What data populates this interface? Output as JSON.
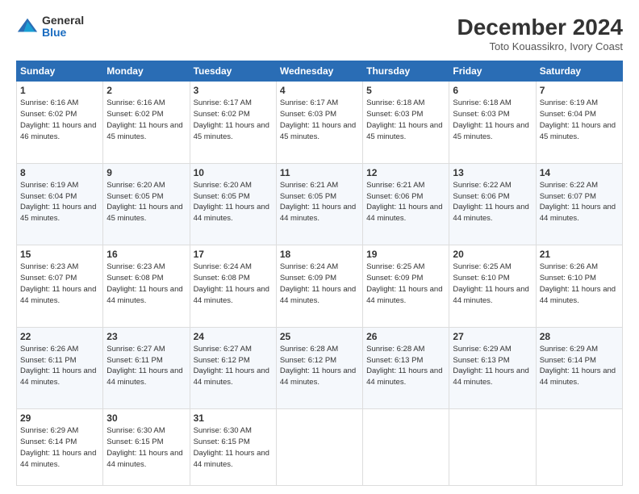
{
  "logo": {
    "general": "General",
    "blue": "Blue"
  },
  "header": {
    "month": "December 2024",
    "location": "Toto Kouassikro, Ivory Coast"
  },
  "days_of_week": [
    "Sunday",
    "Monday",
    "Tuesday",
    "Wednesday",
    "Thursday",
    "Friday",
    "Saturday"
  ],
  "weeks": [
    [
      {
        "day": 1,
        "rise": "6:16 AM",
        "set": "6:02 PM",
        "daylight": "11 hours and 46 minutes."
      },
      {
        "day": 2,
        "rise": "6:16 AM",
        "set": "6:02 PM",
        "daylight": "11 hours and 45 minutes."
      },
      {
        "day": 3,
        "rise": "6:17 AM",
        "set": "6:02 PM",
        "daylight": "11 hours and 45 minutes."
      },
      {
        "day": 4,
        "rise": "6:17 AM",
        "set": "6:03 PM",
        "daylight": "11 hours and 45 minutes."
      },
      {
        "day": 5,
        "rise": "6:18 AM",
        "set": "6:03 PM",
        "daylight": "11 hours and 45 minutes."
      },
      {
        "day": 6,
        "rise": "6:18 AM",
        "set": "6:03 PM",
        "daylight": "11 hours and 45 minutes."
      },
      {
        "day": 7,
        "rise": "6:19 AM",
        "set": "6:04 PM",
        "daylight": "11 hours and 45 minutes."
      }
    ],
    [
      {
        "day": 8,
        "rise": "6:19 AM",
        "set": "6:04 PM",
        "daylight": "11 hours and 45 minutes."
      },
      {
        "day": 9,
        "rise": "6:20 AM",
        "set": "6:05 PM",
        "daylight": "11 hours and 45 minutes."
      },
      {
        "day": 10,
        "rise": "6:20 AM",
        "set": "6:05 PM",
        "daylight": "11 hours and 44 minutes."
      },
      {
        "day": 11,
        "rise": "6:21 AM",
        "set": "6:05 PM",
        "daylight": "11 hours and 44 minutes."
      },
      {
        "day": 12,
        "rise": "6:21 AM",
        "set": "6:06 PM",
        "daylight": "11 hours and 44 minutes."
      },
      {
        "day": 13,
        "rise": "6:22 AM",
        "set": "6:06 PM",
        "daylight": "11 hours and 44 minutes."
      },
      {
        "day": 14,
        "rise": "6:22 AM",
        "set": "6:07 PM",
        "daylight": "11 hours and 44 minutes."
      }
    ],
    [
      {
        "day": 15,
        "rise": "6:23 AM",
        "set": "6:07 PM",
        "daylight": "11 hours and 44 minutes."
      },
      {
        "day": 16,
        "rise": "6:23 AM",
        "set": "6:08 PM",
        "daylight": "11 hours and 44 minutes."
      },
      {
        "day": 17,
        "rise": "6:24 AM",
        "set": "6:08 PM",
        "daylight": "11 hours and 44 minutes."
      },
      {
        "day": 18,
        "rise": "6:24 AM",
        "set": "6:09 PM",
        "daylight": "11 hours and 44 minutes."
      },
      {
        "day": 19,
        "rise": "6:25 AM",
        "set": "6:09 PM",
        "daylight": "11 hours and 44 minutes."
      },
      {
        "day": 20,
        "rise": "6:25 AM",
        "set": "6:10 PM",
        "daylight": "11 hours and 44 minutes."
      },
      {
        "day": 21,
        "rise": "6:26 AM",
        "set": "6:10 PM",
        "daylight": "11 hours and 44 minutes."
      }
    ],
    [
      {
        "day": 22,
        "rise": "6:26 AM",
        "set": "6:11 PM",
        "daylight": "11 hours and 44 minutes."
      },
      {
        "day": 23,
        "rise": "6:27 AM",
        "set": "6:11 PM",
        "daylight": "11 hours and 44 minutes."
      },
      {
        "day": 24,
        "rise": "6:27 AM",
        "set": "6:12 PM",
        "daylight": "11 hours and 44 minutes."
      },
      {
        "day": 25,
        "rise": "6:28 AM",
        "set": "6:12 PM",
        "daylight": "11 hours and 44 minutes."
      },
      {
        "day": 26,
        "rise": "6:28 AM",
        "set": "6:13 PM",
        "daylight": "11 hours and 44 minutes."
      },
      {
        "day": 27,
        "rise": "6:29 AM",
        "set": "6:13 PM",
        "daylight": "11 hours and 44 minutes."
      },
      {
        "day": 28,
        "rise": "6:29 AM",
        "set": "6:14 PM",
        "daylight": "11 hours and 44 minutes."
      }
    ],
    [
      {
        "day": 29,
        "rise": "6:29 AM",
        "set": "6:14 PM",
        "daylight": "11 hours and 44 minutes."
      },
      {
        "day": 30,
        "rise": "6:30 AM",
        "set": "6:15 PM",
        "daylight": "11 hours and 44 minutes."
      },
      {
        "day": 31,
        "rise": "6:30 AM",
        "set": "6:15 PM",
        "daylight": "11 hours and 44 minutes."
      },
      null,
      null,
      null,
      null
    ]
  ]
}
